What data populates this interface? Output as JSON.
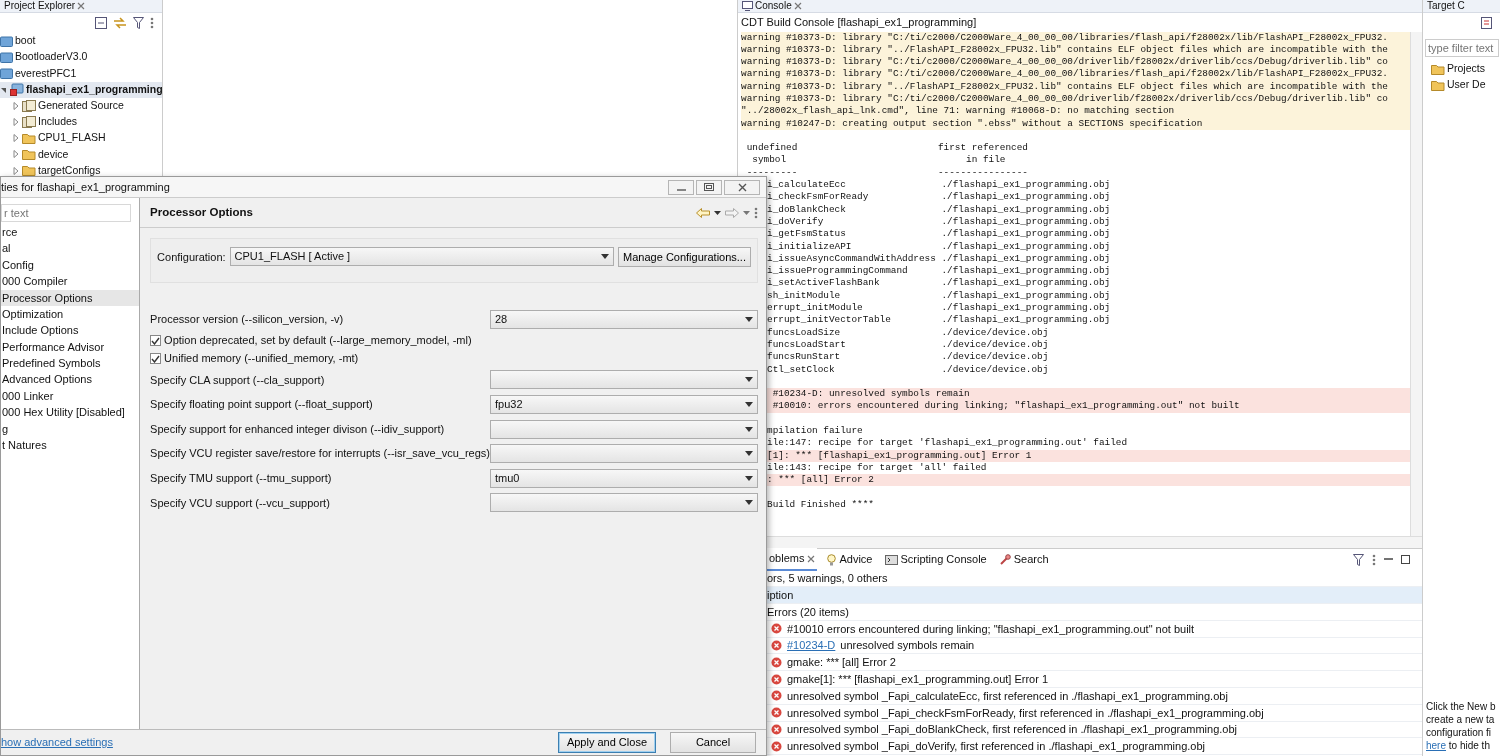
{
  "explorer": {
    "tab": "Project Explorer",
    "items": [
      {
        "label": "boot",
        "kind": "project",
        "selected": false
      },
      {
        "label": "BootloaderV3.0",
        "kind": "project",
        "selected": false
      },
      {
        "label": "everestPFC1",
        "kind": "project",
        "selected": false
      },
      {
        "label": "flashapi_ex1_programming",
        "kind": "active_project",
        "selected": true,
        "expanded": true,
        "children": [
          {
            "label": "Generated Source",
            "kind": "source",
            "selected": false,
            "expanded": false
          },
          {
            "label": "Includes",
            "kind": "includes",
            "selected": false,
            "expanded": false
          },
          {
            "label": "CPU1_FLASH",
            "kind": "folder",
            "selected": false,
            "expanded": false
          },
          {
            "label": "device",
            "kind": "folder",
            "selected": false,
            "expanded": false
          },
          {
            "label": "targetConfigs",
            "kind": "folder",
            "selected": false,
            "expanded": false
          }
        ]
      }
    ]
  },
  "console": {
    "tab": "Console",
    "title": "CDT Build Console [flashapi_ex1_programming]",
    "lines": [
      {
        "kind": "warning",
        "text": "warning #10373-D: library \"C:/ti/c2000/C2000Ware_4_00_00_00/libraries/flash_api/f28002x/lib/FlashAPI_F28002x_FPU32."
      },
      {
        "kind": "warning",
        "text": "warning #10373-D: library \"../FlashAPI_F28002x_FPU32.lib\" contains ELF object files which are incompatible with the"
      },
      {
        "kind": "warning",
        "text": "warning #10373-D: library \"C:/ti/c2000/C2000Ware_4_00_00_00/driverlib/f28002x/driverlib/ccs/Debug/driverlib.lib\" co"
      },
      {
        "kind": "warning",
        "text": "warning #10373-D: library \"C:/ti/c2000/C2000Ware_4_00_00_00/libraries/flash_api/f28002x/lib/FlashAPI_F28002x_FPU32."
      },
      {
        "kind": "warning",
        "text": "warning #10373-D: library \"../FlashAPI_F28002x_FPU32.lib\" contains ELF object files which are incompatible with the"
      },
      {
        "kind": "warning",
        "text": "warning #10373-D: library \"C:/ti/c2000/C2000Ware_4_00_00_00/driverlib/f28002x/driverlib/ccs/Debug/driverlib.lib\" co"
      },
      {
        "kind": "warning",
        "text": "\"../28002x_flash_api_lnk.cmd\", line 71: warning #10068-D: no matching section"
      },
      {
        "kind": "warning",
        "text": "warning #10247-D: creating output section \".ebss\" without a SECTIONS specification"
      },
      {
        "kind": "blank"
      },
      {
        "kind": "plain",
        "text": " undefined                         first referenced"
      },
      {
        "kind": "plain",
        "text": "  symbol                                in file"
      },
      {
        "kind": "plain",
        "text": " ---------                         ----------------"
      }
    ],
    "continued_lines": [
      {
        "kind": "plain",
        "text": "i_calculateEcc                 ./flashapi_ex1_programming.obj"
      },
      {
        "kind": "plain",
        "text": "i_checkFsmForReady             ./flashapi_ex1_programming.obj"
      },
      {
        "kind": "plain",
        "text": "i_doBlankCheck                 ./flashapi_ex1_programming.obj"
      },
      {
        "kind": "plain",
        "text": "i_doVerify                     ./flashapi_ex1_programming.obj"
      },
      {
        "kind": "plain",
        "text": "i_getFsmStatus                 ./flashapi_ex1_programming.obj"
      },
      {
        "kind": "plain",
        "text": "i_initializeAPI                ./flashapi_ex1_programming.obj"
      },
      {
        "kind": "plain",
        "text": "i_issueAsyncCommandWithAddress ./flashapi_ex1_programming.obj"
      },
      {
        "kind": "plain",
        "text": "i_issueProgrammingCommand      ./flashapi_ex1_programming.obj"
      },
      {
        "kind": "plain",
        "text": "i_setActiveFlashBank           ./flashapi_ex1_programming.obj"
      },
      {
        "kind": "plain",
        "text": "sh_initModule                  ./flashapi_ex1_programming.obj"
      },
      {
        "kind": "plain",
        "text": "errupt_initModule              ./flashapi_ex1_programming.obj"
      },
      {
        "kind": "plain",
        "text": "errupt_initVectorTable         ./flashapi_ex1_programming.obj"
      },
      {
        "kind": "plain",
        "text": "funcsLoadSize                  ./device/device.obj"
      },
      {
        "kind": "plain",
        "text": "funcsLoadStart                 ./device/device.obj"
      },
      {
        "kind": "plain",
        "text": "funcsRunStart                  ./device/device.obj"
      },
      {
        "kind": "plain",
        "text": "Ctl_setClock                   ./device/device.obj"
      },
      {
        "kind": "blank"
      },
      {
        "kind": "error",
        "text": " #10234-D: unresolved symbols remain"
      },
      {
        "kind": "error",
        "text": " #10010: errors encountered during linking; \"flashapi_ex1_programming.out\" not built"
      },
      {
        "kind": "blank"
      },
      {
        "kind": "plain",
        "text": "mpilation failure"
      },
      {
        "kind": "plain",
        "text": "ile:147: recipe for target 'flashapi_ex1_programming.out' failed"
      },
      {
        "kind": "error",
        "text": "[1]: *** [flashapi_ex1_programming.out] Error 1"
      },
      {
        "kind": "plain",
        "text": "ile:143: recipe for target 'all' failed"
      },
      {
        "kind": "error",
        "text": ": *** [all] Error 2"
      },
      {
        "kind": "blank"
      },
      {
        "kind": "plain",
        "text": "Build Finished ****"
      }
    ]
  },
  "problems": {
    "tabs": [
      {
        "label": "oblems",
        "kind": "problems",
        "selected": true
      },
      {
        "label": "Advice",
        "kind": "advice",
        "selected": false
      },
      {
        "label": "Scripting Console",
        "kind": "scripting",
        "selected": false
      },
      {
        "label": "Search",
        "kind": "search",
        "selected": false
      }
    ],
    "summary": "ors, 5 warnings, 0 others",
    "column": "iption",
    "group": {
      "label": "Errors (20 items)",
      "expanded": true
    },
    "rows": [
      {
        "text": "#10010 errors encountered during linking; \"flashapi_ex1_programming.out\" not built"
      },
      {
        "link": "#10234-D",
        "text": "unresolved symbols remain"
      },
      {
        "text": "gmake: *** [all] Error 2"
      },
      {
        "text": "gmake[1]: *** [flashapi_ex1_programming.out] Error 1"
      },
      {
        "text": "unresolved symbol _Fapi_calculateEcc, first referenced in ./flashapi_ex1_programming.obj"
      },
      {
        "text": "unresolved symbol _Fapi_checkFsmForReady, first referenced in ./flashapi_ex1_programming.obj"
      },
      {
        "text": "unresolved symbol _Fapi_doBlankCheck, first referenced in ./flashapi_ex1_programming.obj"
      },
      {
        "text": "unresolved symbol _Fapi_doVerify, first referenced in ./flashapi_ex1_programming.obj"
      }
    ]
  },
  "target_panel": {
    "tab": "Target C",
    "filter_placeholder": "type filter text",
    "items": [
      "Projects",
      "User De"
    ],
    "hint_lines": [
      "Click the New b",
      "create a new ta",
      "configuration fi"
    ],
    "hint_link": "here",
    "hint_tail": "to hide th"
  },
  "dialog": {
    "title": "ties for flashapi_ex1_programming",
    "filter_placeholder": "r text",
    "nav": [
      {
        "label": "rce",
        "selected": false
      },
      {
        "label": "al",
        "selected": false
      },
      {
        "label": "Config",
        "selected": false
      },
      {
        "label": "000 Compiler",
        "selected": false
      },
      {
        "label": "Processor Options",
        "selected": true
      },
      {
        "label": "Optimization",
        "selected": false
      },
      {
        "label": "Include Options",
        "selected": false
      },
      {
        "label": "Performance Advisor",
        "selected": false
      },
      {
        "label": "Predefined Symbols",
        "selected": false
      },
      {
        "label": "Advanced Options",
        "selected": false
      },
      {
        "label": "000 Linker",
        "selected": false
      },
      {
        "label": "000 Hex Utility  [Disabled]",
        "selected": false
      },
      {
        "label": "g",
        "selected": false
      },
      {
        "label": "t Natures",
        "selected": false
      }
    ],
    "page_title": "Processor Options",
    "configuration": {
      "label": "Configuration:",
      "value": "CPU1_FLASH  [ Active ]",
      "button": "Manage Configurations..."
    },
    "options": [
      {
        "kind": "select",
        "label": "Processor version (--silicon_version, -v)",
        "value": "28"
      },
      {
        "kind": "checkbox",
        "label": "Option deprecated, set by default (--large_memory_model, -ml)",
        "checked": true
      },
      {
        "kind": "checkbox",
        "label": "Unified memory (--unified_memory, -mt)",
        "checked": true
      },
      {
        "kind": "select",
        "label": "Specify CLA support (--cla_support)"
      },
      {
        "kind": "select",
        "label": "Specify floating point support (--float_support)",
        "value": "fpu32"
      },
      {
        "kind": "select",
        "label": "Specify support for enhanced integer divison (--idiv_support)"
      },
      {
        "kind": "select",
        "label": "Specify VCU register save/restore for interrupts (--isr_save_vcu_regs)"
      },
      {
        "kind": "select",
        "label": "Specify TMU support (--tmu_support)",
        "value": "tmu0"
      },
      {
        "kind": "select",
        "label": "Specify VCU support (--vcu_support)"
      }
    ],
    "advanced_link": "how advanced settings",
    "buttons": [
      {
        "label": "Apply and Close",
        "default": true
      },
      {
        "label": "Cancel",
        "default": false
      }
    ]
  }
}
